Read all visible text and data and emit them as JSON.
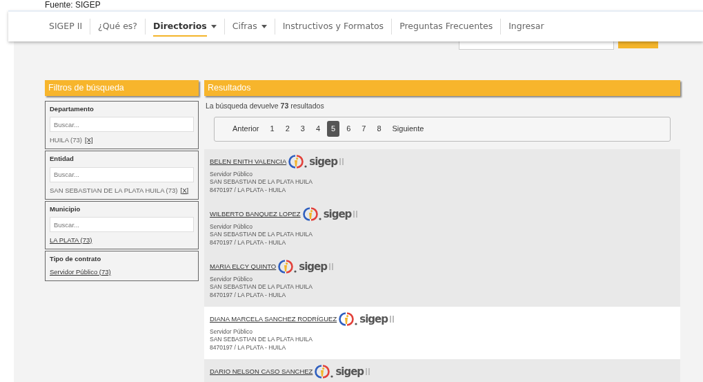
{
  "caption": "Fuente: SIGEP",
  "nav": [
    {
      "label": "SIGEP II",
      "selected": false,
      "dropdown": false
    },
    {
      "label": "¿Qué es?",
      "selected": false,
      "dropdown": false
    },
    {
      "label": "Directorios",
      "selected": true,
      "dropdown": true
    },
    {
      "label": "Cifras",
      "selected": false,
      "dropdown": true
    },
    {
      "label": "Instructivos y Formatos",
      "selected": false,
      "dropdown": false
    },
    {
      "label": "Preguntas Frecuentes",
      "selected": false,
      "dropdown": false
    },
    {
      "label": "Ingresar",
      "selected": false,
      "dropdown": false
    }
  ],
  "filters": {
    "title": "Filtros de búsqueda",
    "groups": [
      {
        "title": "Departamento",
        "placeholder": "Buscar...",
        "option": "HUILA (73)",
        "remove": "[X]",
        "linked": false
      },
      {
        "title": "Entidad",
        "placeholder": "Buscar...",
        "option": "SAN SEBASTIAN DE LA PLATA HUILA (73)",
        "remove": "[X]",
        "linked": false
      },
      {
        "title": "Municipio",
        "placeholder": "Buscar...",
        "option": "LA PLATA (73)",
        "linked": true
      },
      {
        "title": "Tipo de contrato",
        "option": "Servidor Público (73)",
        "linked": true
      }
    ]
  },
  "results": {
    "title": "Resultados",
    "summary": "La búsqueda devuelve **73** resultados",
    "pager": [
      {
        "label": "Anterior",
        "selected": false
      },
      {
        "label": "1",
        "selected": false
      },
      {
        "label": "2",
        "selected": false
      },
      {
        "label": "3",
        "selected": false
      },
      {
        "label": "4",
        "selected": false
      },
      {
        "label": "5",
        "selected": true
      },
      {
        "label": "6",
        "selected": false
      },
      {
        "label": "7",
        "selected": false
      },
      {
        "label": "8",
        "selected": false
      },
      {
        "label": "Siguiente",
        "selected": false
      }
    ],
    "rows": [
      {
        "name": "BELEN ENITH VALENCIA",
        "logo": "sigep",
        "shaded": true,
        "lines": [
          "Servidor Público",
          "SAN SEBASTIAN DE LA PLATA HUILA",
          "8470197 / LA PLATA - HUILA"
        ]
      },
      {
        "name": "WILBERTO BANQUEZ LOPEZ",
        "logo": "sigep",
        "shaded": true,
        "lines": [
          "Servidor Público",
          "SAN SEBASTIAN DE LA PLATA HUILA",
          "8470197 / LA PLATA - HUILA"
        ]
      },
      {
        "name": "MARIA ELCY QUINTO",
        "logo": "sigep",
        "shaded": true,
        "lines": [
          "Servidor Público",
          "SAN SEBASTIAN DE LA PLATA HUILA",
          "8470197 / LA PLATA - HUILA"
        ]
      },
      {
        "name": "DIANA MARCELA SANCHEZ RODRÍGUEZ",
        "logo": "sigep",
        "shaded": false,
        "lines": [
          "Servidor Público",
          "SAN SEBASTIAN DE LA PLATA HUILA",
          "8470197 / LA PLATA - HUILA"
        ]
      },
      {
        "name": "DARIO NELSON CASO SANCHEZ",
        "logo": "sigep",
        "shaded": true,
        "lines": []
      }
    ]
  }
}
